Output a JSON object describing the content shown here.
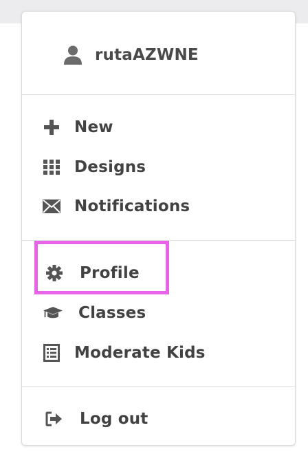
{
  "user": {
    "name": "rutaAZWNE",
    "icon": "user-icon"
  },
  "menu": {
    "primary": [
      {
        "label": "New",
        "icon": "plus-icon"
      },
      {
        "label": "Designs",
        "icon": "grid-icon"
      },
      {
        "label": "Notifications",
        "icon": "envelope-icon"
      }
    ],
    "secondary": [
      {
        "label": "Profile",
        "icon": "gear-icon",
        "highlighted": true
      },
      {
        "label": "Classes",
        "icon": "graduation-cap-icon"
      },
      {
        "label": "Moderate Kids",
        "icon": "list-icon"
      }
    ],
    "footer": [
      {
        "label": "Log out",
        "icon": "sign-out-icon"
      }
    ]
  },
  "colors": {
    "text": "#424242",
    "icon": "#555555",
    "highlight": "#e763e8",
    "border": "#d9dbdf"
  }
}
